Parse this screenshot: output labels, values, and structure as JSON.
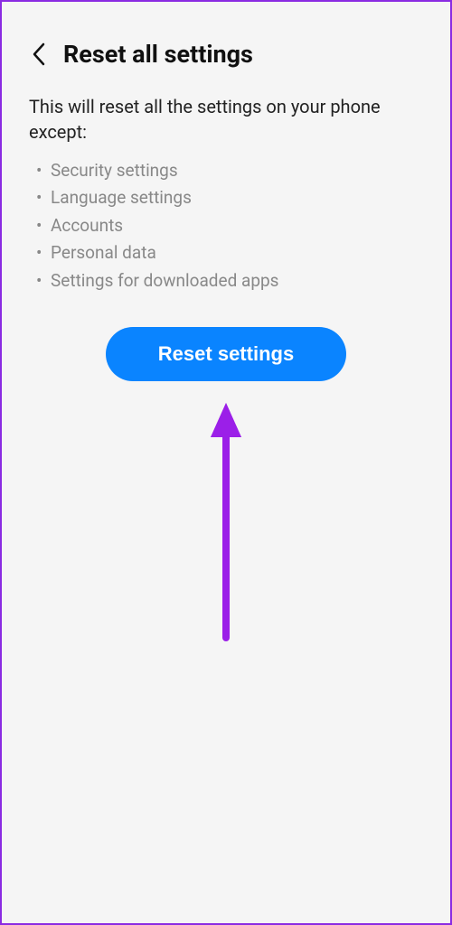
{
  "header": {
    "title": "Reset all settings"
  },
  "description": "This will reset all the settings on your phone except:",
  "exceptions": [
    "Security settings",
    "Language settings",
    "Accounts",
    "Personal data",
    "Settings for downloaded apps"
  ],
  "button": {
    "label": "Reset settings"
  },
  "colors": {
    "accent": "#0a84ff",
    "annotation": "#9b1fe8"
  }
}
